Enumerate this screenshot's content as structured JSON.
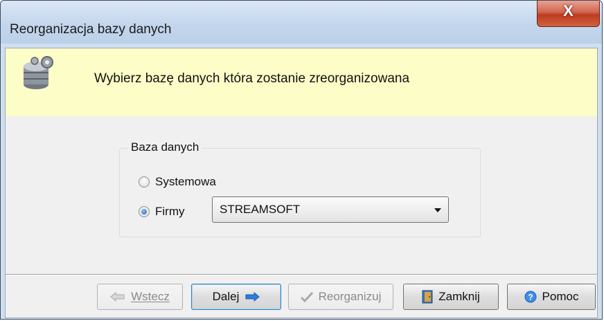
{
  "window": {
    "title": "Reorganizacja bazy danych",
    "close_symbol": "X"
  },
  "banner": {
    "icon": "database-gear-icon",
    "text": "Wybierz bazę danych która zostanie zreorganizowana"
  },
  "database_group": {
    "legend": "Baza danych",
    "options": [
      {
        "label": "Systemowa",
        "selected": false
      },
      {
        "label": "Firmy",
        "selected": true
      }
    ],
    "company_select": {
      "value": "STREAMSOFT"
    }
  },
  "buttons": {
    "back": {
      "label": "Wstecz",
      "enabled": false,
      "icon": "arrow-left-icon"
    },
    "next": {
      "label": "Dalej",
      "enabled": true,
      "icon": "arrow-right-icon"
    },
    "reorganize": {
      "label": "Reorganizuj",
      "enabled": false,
      "icon": "checkmark-icon"
    },
    "close": {
      "label": "Zamknij",
      "enabled": true,
      "icon": "door-icon"
    },
    "help": {
      "label": "Pomoc",
      "enabled": true,
      "icon": "help-icon"
    }
  },
  "colors": {
    "banner_bg": "#fdfdc8",
    "arrow_blue": "#2a7de1",
    "close_red": "#c44a30"
  }
}
